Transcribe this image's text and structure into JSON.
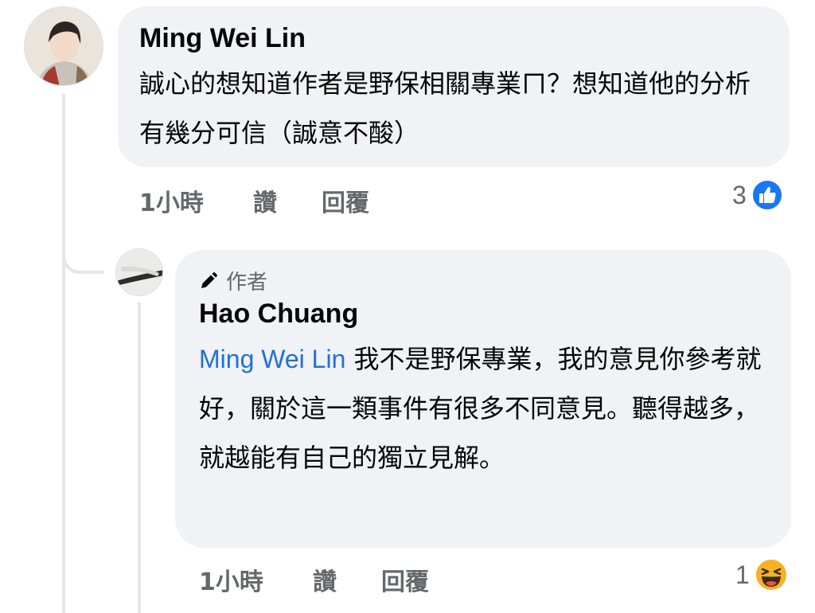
{
  "comment": {
    "author": "Ming Wei Lin",
    "text": "誠心的想知道作者是野保相關專業ㄇ？想知道他的分析有幾分可信（誠意不酸）",
    "time": "1小時",
    "like_label": "讚",
    "reply_label": "回覆",
    "reaction_count": "3",
    "reaction_icon": "like-icon",
    "reaction_color": "#1877f2"
  },
  "reply": {
    "badge_icon": "pencil-icon",
    "badge_label": "作者",
    "author": "Hao Chuang",
    "mention": "Ming Wei Lin",
    "text": " 我不是野保專業，我的意見你參考就好，關於這一類事件有很多不同意見。聽得越多，就越能有自己的獨立見解。",
    "time": "1小時",
    "like_label": "讚",
    "reply_label": "回覆",
    "reaction_count": "1",
    "reaction_icon": "haha-icon",
    "reaction_color": "#f7b125"
  },
  "colors": {
    "bubble": "#f0f2f5",
    "secondary_text": "#65676b",
    "mention": "#216fdb"
  }
}
